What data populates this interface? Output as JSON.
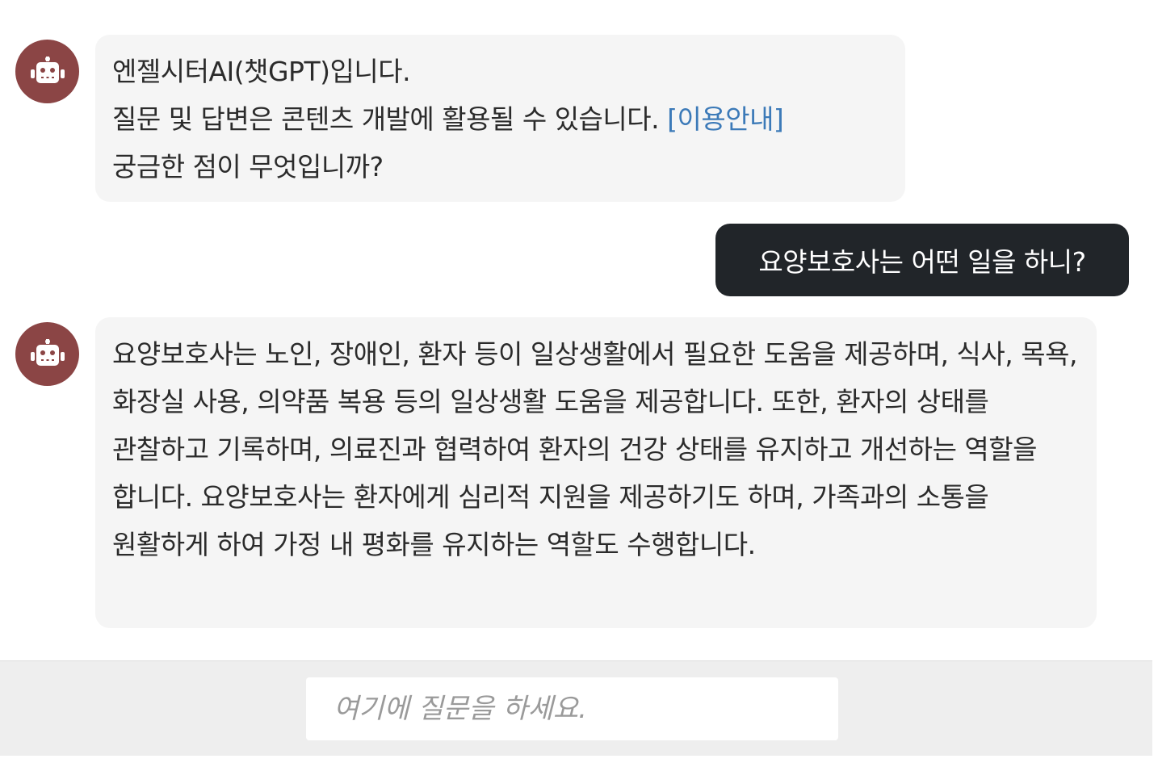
{
  "messages": {
    "greeting": {
      "line1": "엔젤시터AI(챗GPT)입니다.",
      "line2_text": "질문 및 답변은 콘텐츠 개발에 활용될 수 있습니다. ",
      "line2_link": "[이용안내]",
      "line3": "궁금한 점이 무엇입니까?"
    },
    "user_question": "요양보호사는 어떤 일을 하니?",
    "answer": "요양보호사는 노인, 장애인, 환자 등이 일상생활에서 필요한 도움을 제공하며, 식사, 목욕, 화장실 사용, 의약품 복용 등의 일상생활 도움을 제공합니다. 또한, 환자의 상태를 관찰하고 기록하며, 의료진과 협력하여 환자의 건강 상태를 유지하고 개선하는 역할을 합니다. 요양보호사는 환자에게 심리적 지원을 제공하기도 하며, 가족과의 소통을 원활하게 하여 가정 내 평화를 유지하는 역할도 수행합니다."
  },
  "input": {
    "placeholder": "여기에 질문을 하세요.",
    "value": ""
  },
  "icons": {
    "bot_avatar": "robot-icon"
  },
  "colors": {
    "avatar_bg": "#8b4545",
    "bot_bubble_bg": "#f5f5f5",
    "user_bubble_bg": "#212529",
    "link": "#3c7ab8",
    "footer_bg": "#eeeeee"
  }
}
